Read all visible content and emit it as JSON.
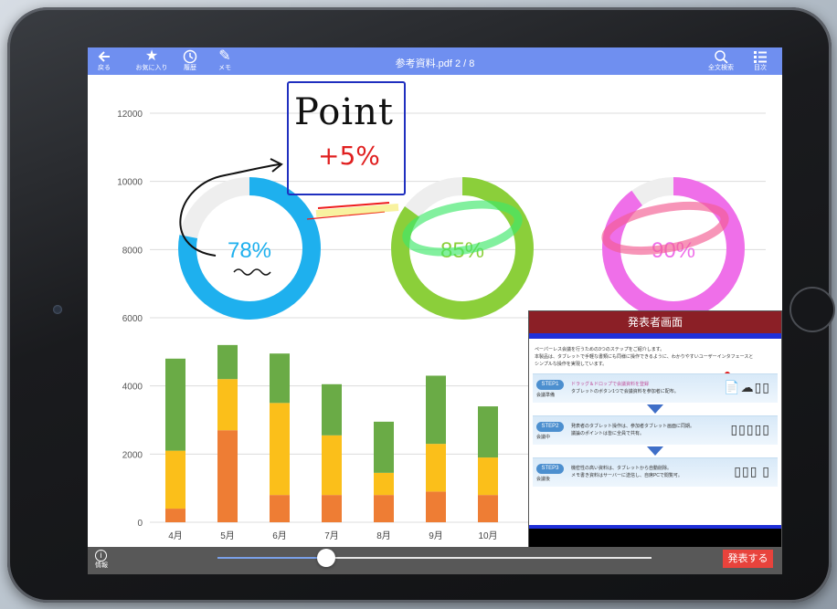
{
  "toolbar": {
    "title": "参考資料.pdf",
    "page_indicator": "2 / 8",
    "left_buttons": [
      {
        "label": "戻る",
        "icon": "back-arrow-icon"
      },
      {
        "label": "お気に入り",
        "icon": "star-icon"
      },
      {
        "label": "履歴",
        "icon": "clock-icon"
      },
      {
        "label": "メモ",
        "icon": "pencil-icon"
      }
    ],
    "right_buttons": [
      {
        "label": "全文検索",
        "icon": "search-icon"
      },
      {
        "label": "目次",
        "icon": "list-icon"
      }
    ],
    "color": "#6f8ff0"
  },
  "chart_data": [
    {
      "type": "bar",
      "stacked": true,
      "categories": [
        "4月",
        "5月",
        "6月",
        "7月",
        "8月",
        "9月",
        "10月"
      ],
      "ylim": [
        0,
        12000
      ],
      "yticks": [
        0,
        2000,
        4000,
        6000,
        8000,
        10000,
        12000
      ],
      "grid": true,
      "series": [
        {
          "color": "#ee7d34",
          "values": [
            400,
            2700,
            800,
            800,
            800,
            900,
            800
          ]
        },
        {
          "color": "#fbbf1a",
          "values": [
            1700,
            1500,
            2700,
            1750,
            650,
            1400,
            1100
          ]
        },
        {
          "color": "#6aab46",
          "values": [
            2700,
            1000,
            1450,
            1500,
            1500,
            2000,
            1500
          ]
        }
      ]
    },
    {
      "type": "pie",
      "donuts": [
        {
          "label": "78%",
          "value": 78,
          "color": "#1eb0ee"
        },
        {
          "label": "85%",
          "value": 85,
          "color": "#8bcf3a"
        },
        {
          "label": "90%",
          "value": 90,
          "color": "#ef6fe9"
        }
      ]
    }
  ],
  "annotation": {
    "title": "Point",
    "value": "+5%"
  },
  "presenter": {
    "title": "発表者画面",
    "intro_line1": "ペーパーレス会議を行うための3つのステップをご紹介します。",
    "intro_line2": "本製品は、タブレットで手軽な書類にも同様に操作できるように、わかりやすいユーザーインタフェースと",
    "intro_line3": "シンプルな操作を実現しています。",
    "steps": [
      {
        "badge": "STEP1",
        "sub": "会議準備",
        "text1": "ドラッグ＆ドロップで会議資料を登録",
        "text2": "タブレットのボタン1つで会議資料を参加者に配布。",
        "icons": "📄☁▯▯"
      },
      {
        "badge": "STEP2",
        "sub": "会議中",
        "text1": "発表者のタブレット操作は、参加者タブレット画面に同期。",
        "text2": "議論のポイントは皆に全員で共有。",
        "icons": "▯▯▯▯▯"
      },
      {
        "badge": "STEP3",
        "sub": "会議後",
        "text1": "機密性の高い資料は、タブレットから自動削除。",
        "text2": "メモ書き資料はサーバーに送信し、自席PCで閲覧可。",
        "icons": "▯▯▯ ▯"
      }
    ]
  },
  "bottombar": {
    "info_label": "情報",
    "present_label": "発表する",
    "slider_value": 0.25,
    "present_color": "#e8433c"
  }
}
